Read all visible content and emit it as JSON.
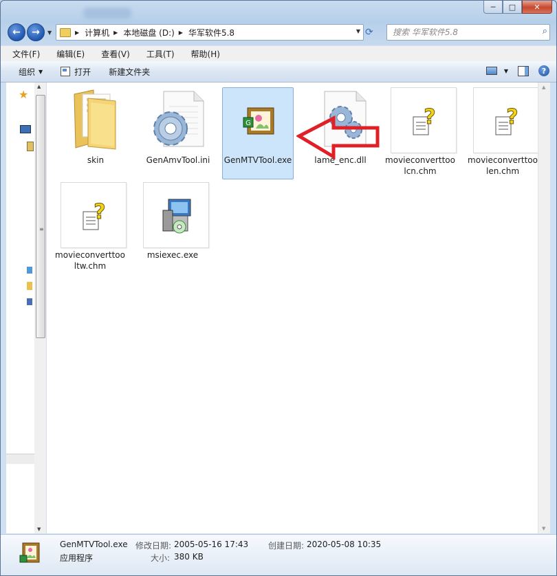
{
  "window": {
    "controls": {
      "minimize": "─",
      "maximize": "□",
      "close": "✕"
    }
  },
  "nav": {
    "back_glyph": "←",
    "forward_glyph": "→",
    "breadcrumbs": [
      "计算机",
      "本地磁盘 (D:)",
      "华军软件5.8"
    ],
    "search_placeholder": "搜索 华军软件5.8"
  },
  "menu": [
    "文件(F)",
    "编辑(E)",
    "查看(V)",
    "工具(T)",
    "帮助(H)"
  ],
  "toolbar": {
    "organize": "组织",
    "open": "打开",
    "new_folder": "新建文件夹",
    "help_glyph": "?"
  },
  "files": [
    {
      "name": "skin",
      "icon": "folder-icon"
    },
    {
      "name": "GenAmvTool.ini",
      "icon": "settings-file-icon"
    },
    {
      "name": "GenMTVTool.exe",
      "icon": "app-icon",
      "selected": true
    },
    {
      "name": "lame_enc.dll",
      "icon": "dll-icon"
    },
    {
      "name": "movieconverttoolcn.chm",
      "icon": "chm-help-icon"
    },
    {
      "name": "movieconverttoolen.chm",
      "icon": "chm-help-icon"
    },
    {
      "name": "movieconverttooltw.chm",
      "icon": "chm-help-icon"
    },
    {
      "name": "msiexec.exe",
      "icon": "installer-icon"
    }
  ],
  "details": {
    "file_name": "GenMTVTool.exe",
    "file_type": "应用程序",
    "modified_label": "修改日期:",
    "modified_value": "2005-05-16 17:43",
    "created_label": "创建日期:",
    "created_value": "2020-05-08 10:35",
    "size_label": "大小:",
    "size_value": "380 KB"
  },
  "colors": {
    "annotation_arrow": "#e02027",
    "selection": "#cde5fb"
  }
}
